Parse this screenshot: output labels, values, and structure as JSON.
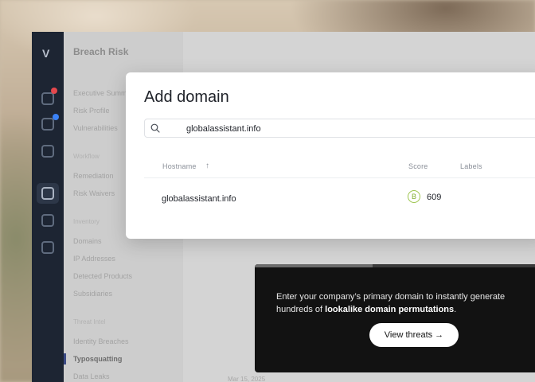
{
  "app": {
    "title": "Breach Risk",
    "nav_items": [
      "Executive Summary",
      "Risk Profile",
      "Vulnerabilities"
    ],
    "nav_section_workflow": "Workflow",
    "workflow_items": [
      "Remediation",
      "Risk Waivers"
    ],
    "nav_section_inventory": "Inventory",
    "inventory_items": [
      "Domains",
      "IP Addresses",
      "Detected Products",
      "Subsidiaries"
    ],
    "nav_section_threat": "Threat Intel",
    "threat_items": [
      "Identity Breaches",
      "Typosquatting",
      "Data Leaks"
    ],
    "background_row": "Mar 15, 2025"
  },
  "modal": {
    "title": "Add domain",
    "search": {
      "value": "globalassistant.info",
      "icon": "search-icon"
    },
    "columns": {
      "hostname": "Hostname",
      "hostname_sort": "↑",
      "score": "Score",
      "labels": "Labels"
    },
    "rows": [
      {
        "hostname": "globalassistant.info",
        "grade": "B",
        "score": "609"
      }
    ]
  },
  "promo": {
    "text_before": "Enter your company’s primary domain to instantly generate hundreds of ",
    "text_bold": "lookalike domain permutations",
    "text_after": ".",
    "button_label": "View threats →",
    "progress": 0.4
  },
  "colors": {
    "accent_green": "#9cc44c",
    "promo_bg": "#121212",
    "rail_bg": "#1d2533"
  }
}
